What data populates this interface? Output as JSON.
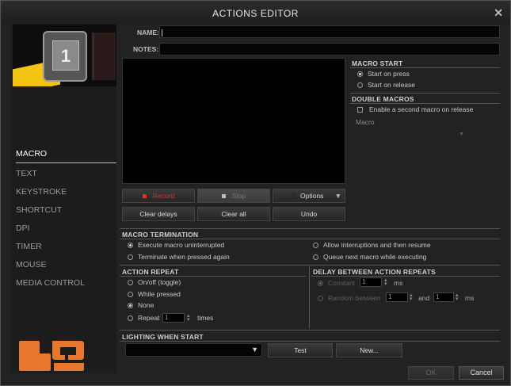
{
  "window": {
    "title": "ACTIONS EDITOR",
    "close_icon": "close-icon"
  },
  "thumb": {
    "key_number": "1"
  },
  "nav": [
    "MACRO",
    "TEXT",
    "KEYSTROKE",
    "SHORTCUT",
    "DPI",
    "TIMER",
    "MOUSE",
    "MEDIA CONTROL"
  ],
  "form": {
    "name_label": "NAME:",
    "name_value": "",
    "notes_label": "NOTES:",
    "notes_value": ""
  },
  "macro_start": {
    "title": "MACRO START",
    "options": [
      "Start on press",
      "Start on release"
    ],
    "selected": 0
  },
  "double_macros": {
    "title": "DOUBLE MACROS",
    "checkbox_label": "Enable a second macro on release",
    "checked": false,
    "macro_label": "Macro",
    "dropdown_arrow": "▼"
  },
  "toolbar": {
    "record": "Record",
    "stop": "Stop",
    "options": "Options",
    "options_arrow": "▼",
    "clear_delays": "Clear delays",
    "clear_all": "Clear all",
    "undo": "Undo"
  },
  "termination": {
    "title": "MACRO TERMINATION",
    "options": [
      "Execute macro uninterrupted",
      "Terminate when pressed again",
      "Allow interruptions and then resume",
      "Queue next macro while executing"
    ],
    "selected": 0
  },
  "repeat": {
    "title": "ACTION REPEAT",
    "options": [
      "On/off (toggle)",
      "While pressed",
      "None",
      "Repeat"
    ],
    "selected": 2,
    "repeat_count": "1",
    "times_label": "times"
  },
  "delay": {
    "title": "DELAY BETWEEN ACTION REPEATS",
    "constant_label": "Constant",
    "constant_value": "1",
    "ms": "ms",
    "random_label": "Random between",
    "random_min": "1",
    "and_label": "and",
    "random_max": "1",
    "ms2": "ms",
    "selected": 0
  },
  "lighting": {
    "title": "LIGHTING WHEN START",
    "select_arrow": "▼",
    "test": "Test",
    "new": "New..."
  },
  "footer": {
    "ok": "OK",
    "cancel": "Cancel"
  },
  "colors": {
    "logo": "#e8772e",
    "accent_yellow": "#f3c413",
    "record_red": "#e03030"
  }
}
